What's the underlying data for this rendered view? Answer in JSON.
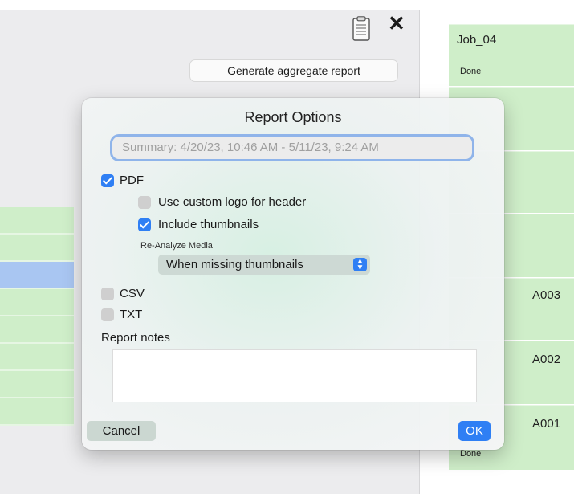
{
  "header": {
    "generate_button": "Generate aggregate report"
  },
  "jobs": [
    {
      "title": "Job_04",
      "status": "Done"
    },
    {
      "title": "A003",
      "status": ""
    },
    {
      "title": "A002",
      "status": ""
    },
    {
      "title": "A001",
      "status": "Done"
    }
  ],
  "dialog": {
    "title": "Report Options",
    "summary_value": "Summary: 4/20/23, 10:46 AM - 5/11/23, 9:24 AM",
    "pdf_label": "PDF",
    "pdf_checked": true,
    "custom_logo_label": "Use custom logo for header",
    "custom_logo_checked": false,
    "thumbnails_label": "Include thumbnails",
    "thumbnails_checked": true,
    "reanalyze_label": "Re-Analyze Media",
    "reanalyze_value": "When missing thumbnails",
    "csv_label": "CSV",
    "csv_checked": false,
    "txt_label": "TXT",
    "txt_checked": false,
    "notes_label": "Report notes",
    "notes_value": "",
    "cancel_label": "Cancel",
    "ok_label": "OK"
  },
  "colors": {
    "accent": "#2f7ff4",
    "job_card": "#cfeec9",
    "selection": "#a9c6f2"
  },
  "icons": [
    "document-icon",
    "close-icon",
    "chevron-updown-icon",
    "checkmark-icon"
  ]
}
